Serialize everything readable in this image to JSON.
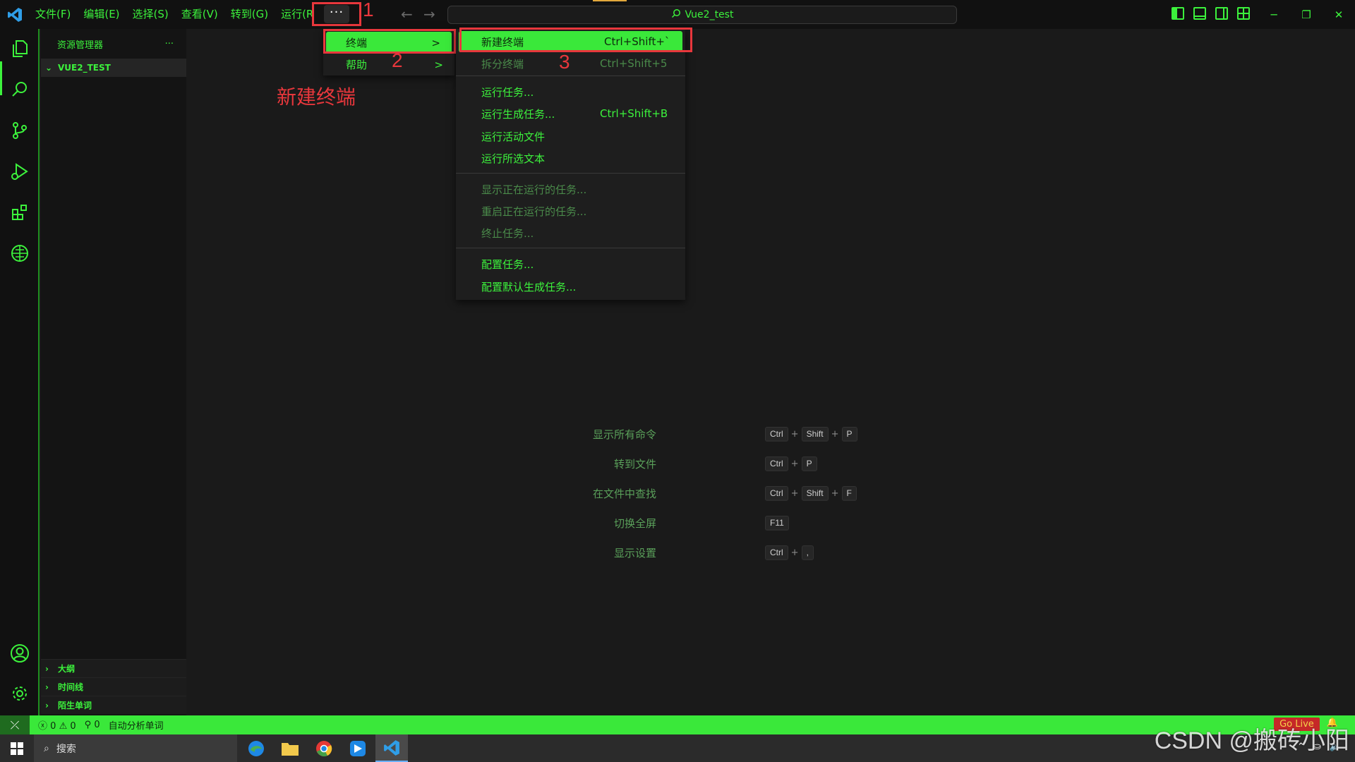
{
  "menubar": {
    "items": [
      "文件(F)",
      "编辑(E)",
      "选择(S)",
      "查看(V)",
      "转到(G)",
      "运行(R"
    ],
    "more": "···"
  },
  "annotations": {
    "n1": "1",
    "n2": "2",
    "n3": "3",
    "note": "新建终端"
  },
  "command_center": {
    "label": "Vue2_test"
  },
  "sidebar": {
    "title": "资源管理器",
    "more": "···",
    "folder": "VUE2_TEST",
    "sections": [
      "大纲",
      "时间线",
      "陌生单词"
    ]
  },
  "menu": {
    "items": [
      {
        "label": "终端",
        "arrow": ">"
      },
      {
        "label": "帮助",
        "arrow": ">"
      }
    ]
  },
  "submenu": {
    "items": [
      {
        "label": "新建终端",
        "key": "Ctrl+Shift+`",
        "state": "selected"
      },
      {
        "label": "拆分终端",
        "key": "Ctrl+Shift+5",
        "state": "disabled"
      },
      {
        "label": "运行任务...",
        "key": "",
        "state": "enabled"
      },
      {
        "label": "运行生成任务...",
        "key": "Ctrl+Shift+B",
        "state": "enabled"
      },
      {
        "label": "运行活动文件",
        "key": "",
        "state": "enabled"
      },
      {
        "label": "运行所选文本",
        "key": "",
        "state": "enabled"
      },
      {
        "label": "显示正在运行的任务...",
        "key": "",
        "state": "disabled"
      },
      {
        "label": "重启正在运行的任务...",
        "key": "",
        "state": "disabled"
      },
      {
        "label": "终止任务...",
        "key": "",
        "state": "disabled"
      },
      {
        "label": "配置任务...",
        "key": "",
        "state": "enabled"
      },
      {
        "label": "配置默认生成任务...",
        "key": "",
        "state": "enabled"
      }
    ]
  },
  "watermark": [
    {
      "label": "显示所有命令",
      "keys": [
        "Ctrl",
        "Shift",
        "P"
      ]
    },
    {
      "label": "转到文件",
      "keys": [
        "Ctrl",
        "P"
      ]
    },
    {
      "label": "在文件中查找",
      "keys": [
        "Ctrl",
        "Shift",
        "F"
      ]
    },
    {
      "label": "切换全屏",
      "keys": [
        "F11"
      ]
    },
    {
      "label": "显示设置",
      "keys": [
        "Ctrl",
        ","
      ]
    }
  ],
  "statusbar": {
    "errors": "0",
    "warnings": "0",
    "ports": "0",
    "extension_text": "自动分析单词",
    "golive": "Go Live"
  },
  "taskbar": {
    "search_placeholder": "搜索"
  },
  "watermark_text": "CSDN @搬砖小阳",
  "colors": {
    "accent": "#3ae83a",
    "annotation": "#e8373c",
    "background": "#1a1a1a"
  }
}
